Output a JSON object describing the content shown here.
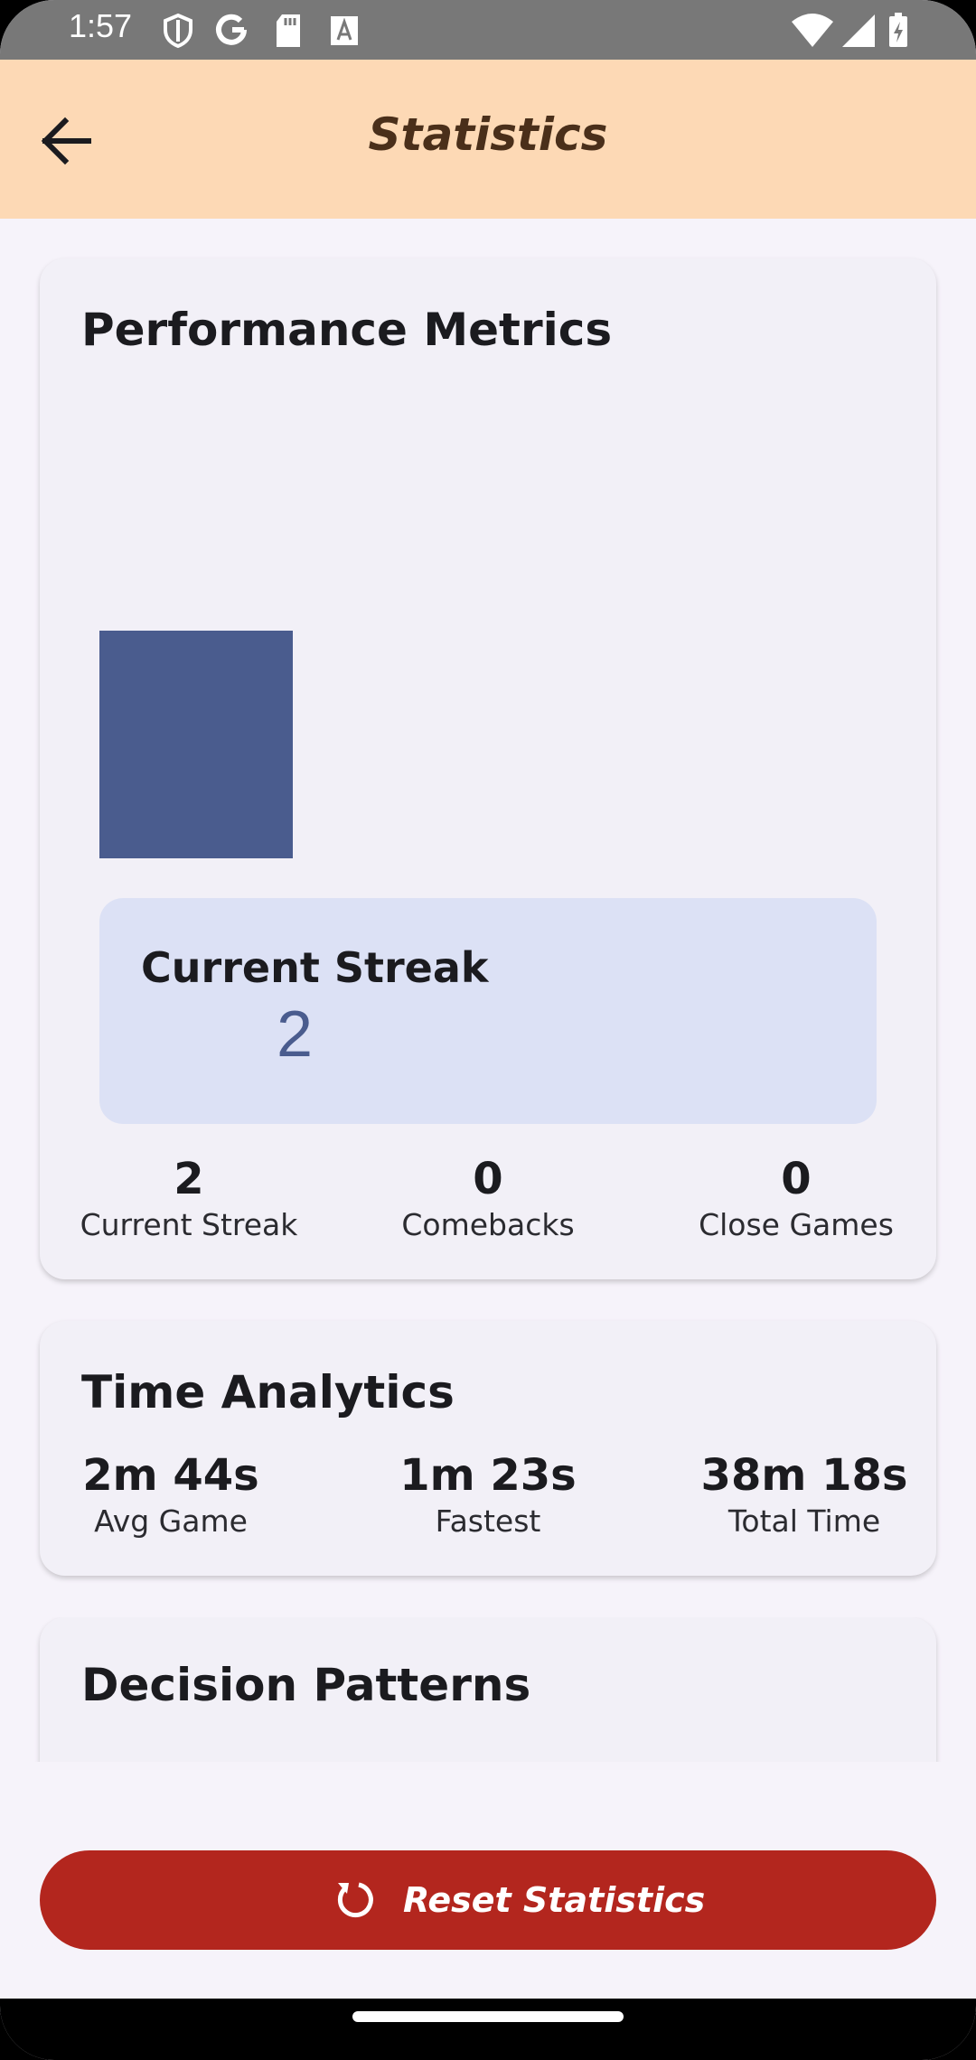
{
  "status_bar": {
    "time": "1:57"
  },
  "app_bar": {
    "title": "Statistics"
  },
  "performance": {
    "title": "Performance Metrics",
    "streak_box": {
      "label": "Current Streak",
      "value": "2"
    },
    "metrics": [
      {
        "value": "2",
        "label": "Current Streak"
      },
      {
        "value": "0",
        "label": "Comebacks"
      },
      {
        "value": "0",
        "label": "Close Games"
      }
    ]
  },
  "time_analytics": {
    "title": "Time Analytics",
    "metrics": [
      {
        "value": "2m 44s",
        "label": "Avg Game"
      },
      {
        "value": "1m 23s",
        "label": "Fastest"
      },
      {
        "value": "38m 18s",
        "label": "Total Time"
      }
    ]
  },
  "decision_patterns": {
    "title": "Decision Patterns"
  },
  "reset": {
    "label": "Reset Statistics"
  },
  "colors": {
    "app_bar": "#fdd9b5",
    "bar": "#4a5c8e",
    "streak_box": "#dce1f5",
    "reset_button": "#b3261e"
  }
}
